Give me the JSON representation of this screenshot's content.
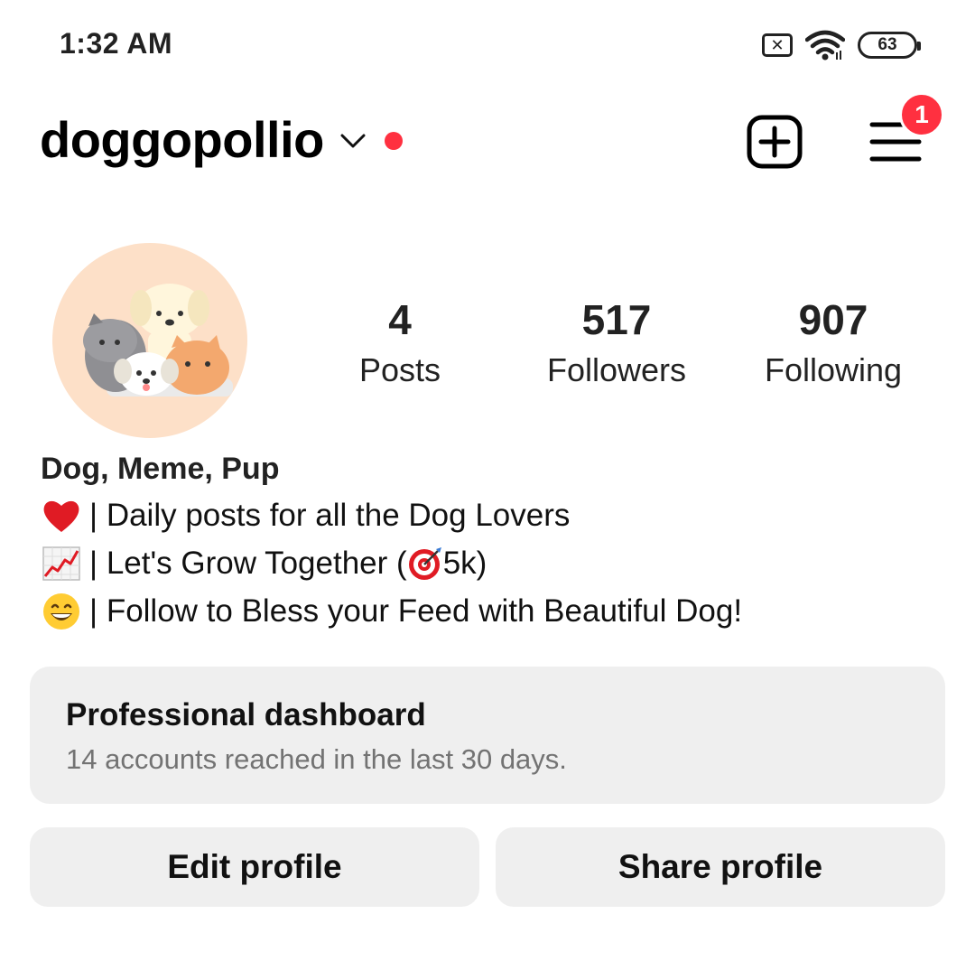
{
  "status_bar": {
    "time": "1:32 AM",
    "battery": "63",
    "icons": [
      "sim-disabled-icon",
      "wifi-icon",
      "battery-icon"
    ]
  },
  "header": {
    "username": "doggopollio",
    "menu_badge": "1",
    "accent": "#ff3040"
  },
  "stats": [
    {
      "value": "4",
      "label": "Posts"
    },
    {
      "value": "517",
      "label": "Followers"
    },
    {
      "value": "907",
      "label": "Following"
    }
  ],
  "bio": {
    "name": "Dog, Meme, Pup",
    "lines": [
      {
        "emoji": "heart-emoji",
        "text": " | Daily posts for all the Dog Lovers"
      },
      {
        "emoji": "chart-increasing-emoji",
        "text_before": " | Let's Grow Together (",
        "inline_emoji": "target-emoji",
        "text_after": "5k)"
      },
      {
        "emoji": "grinning-face-emoji",
        "text": " | Follow to Bless your Feed with Beautiful Dog!"
      }
    ]
  },
  "dashboard": {
    "title": "Professional dashboard",
    "subtitle": "14 accounts reached in the last 30 days."
  },
  "buttons": {
    "edit": "Edit profile",
    "share": "Share profile"
  }
}
